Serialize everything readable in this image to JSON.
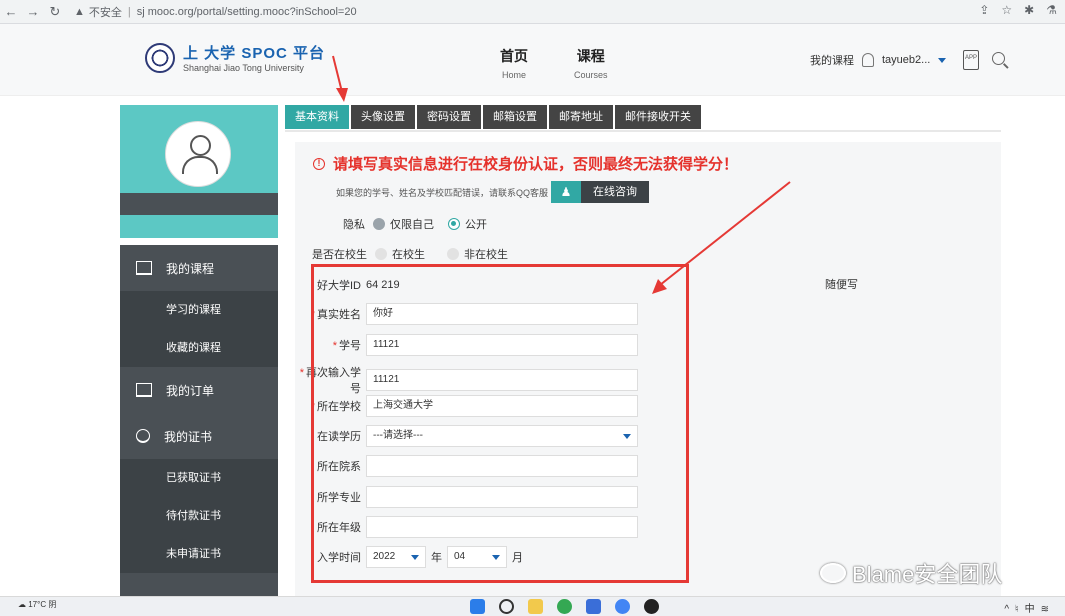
{
  "browser": {
    "security_label": "不安全",
    "url": "sj        mooc.org/portal/setting.mooc?inSchool=20"
  },
  "header": {
    "logo_cn": "上      大学 SPOC 平台",
    "logo_en": "Shanghai Jiao Tong University",
    "nav": [
      {
        "cn": "首页",
        "en": "Home"
      },
      {
        "cn": "课程",
        "en": "Courses"
      }
    ],
    "my_courses": "我的课程",
    "username": "tayueb2...",
    "app_label": "APP"
  },
  "sidebar": {
    "groups": [
      {
        "label": "我的课程",
        "items": [
          "学习的课程",
          "收藏的课程"
        ]
      },
      {
        "label": "我的订单",
        "items": []
      },
      {
        "label": "我的证书",
        "items": [
          "已获取证书",
          "待付款证书",
          "未申请证书"
        ]
      }
    ]
  },
  "tabs": [
    "基本资料",
    "头像设置",
    "密码设置",
    "邮箱设置",
    "邮寄地址",
    "邮件接收开关"
  ],
  "notice": "请填写真实信息进行在校身份认证，否则最终无法获得学分！",
  "hint": "如果您的学号、姓名及学校匹配错误，请联系QQ客服",
  "online_consult": "在线咨询",
  "privacy": {
    "label": "隐私",
    "opt1": "仅限自己",
    "opt2": "公开"
  },
  "inschool": {
    "label": "是否在校生",
    "opt1": "在校生",
    "opt2": "非在校生"
  },
  "form": {
    "id_label": "好大学ID",
    "id_value": "64     219",
    "real_name_label": "真实姓名",
    "real_name_value": "你好",
    "student_no_label": "学号",
    "student_no_value": "11121",
    "student_no2_label": "再次输入学号",
    "student_no2_value": "11121",
    "school_label": "所在学校",
    "school_value": "上海交通大学",
    "education_label": "在读学历",
    "education_value": "---请选择---",
    "college_label": "所在院系",
    "major_label": "所学专业",
    "grade_label": "所在年级",
    "enroll_label": "入学时间",
    "enroll_year": "2022",
    "year_unit": "年",
    "enroll_month": "04",
    "month_unit": "月"
  },
  "free_text": "随便写",
  "taskbar": {
    "temp": "17°C",
    "weather": "阴",
    "ime": "中"
  },
  "watermark": "Blame安全团队",
  "colors": {
    "accent": "#31a8a4",
    "warning": "#e5322c",
    "sidebar": "#3c4246",
    "annotation": "#e53935"
  }
}
